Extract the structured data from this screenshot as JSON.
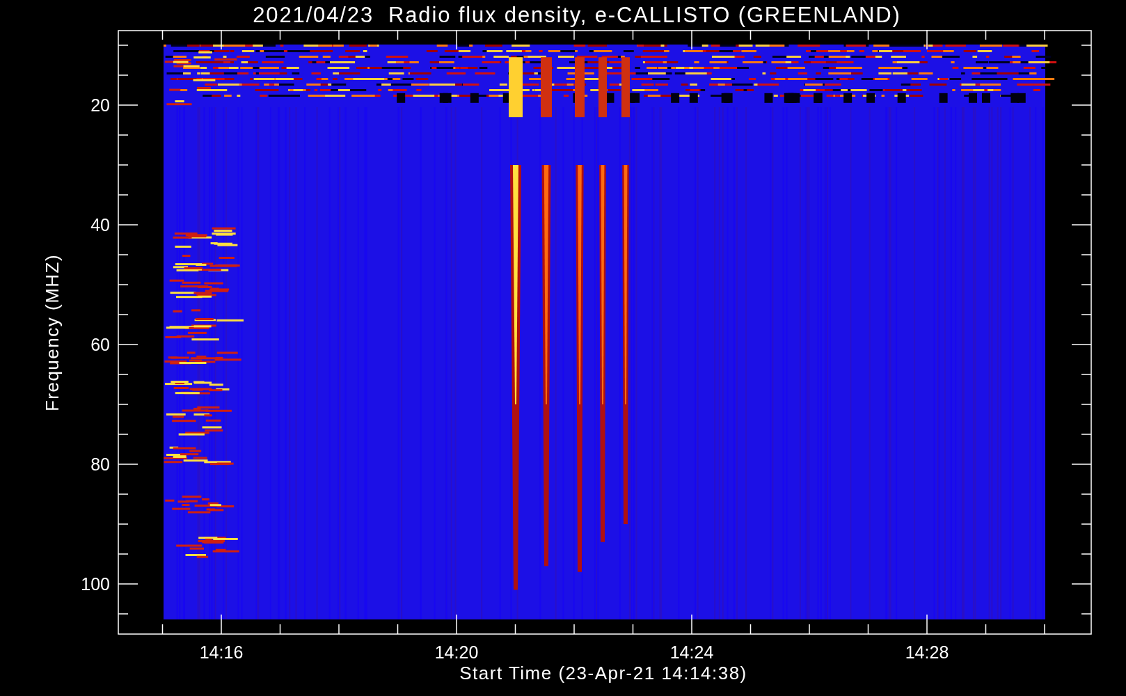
{
  "plot": {
    "title": "2021/04/23  Radio flux density, e-CALLISTO (GREENLAND)",
    "xlabel": "Start Time (23-Apr-21 14:14:38)",
    "ylabel": "Frequency (MHZ)",
    "yticks": [
      "20",
      "40",
      "60",
      "80",
      "100"
    ],
    "xticks": [
      "14:16",
      "14:20",
      "14:24",
      "14:28"
    ]
  }
}
